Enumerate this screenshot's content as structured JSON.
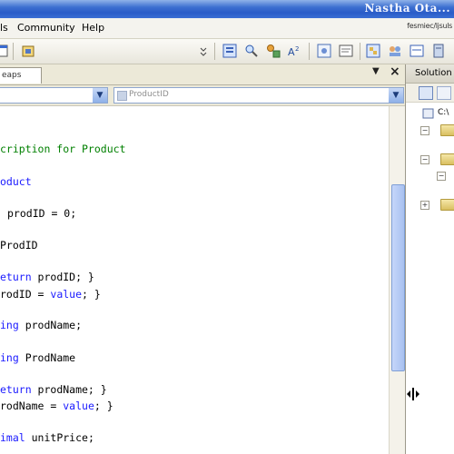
{
  "window": {
    "title": "Nastha Ota..."
  },
  "menu": {
    "items": [
      "ls",
      "Community",
      "Help"
    ],
    "user": "fesmiec/ljsuls"
  },
  "editor_tab": {
    "label": "eaps"
  },
  "nav": {
    "member_combo": "ProductID"
  },
  "code_lines": [
    {
      "segments": [
        {
          "t": "cription for Product",
          "c": "cm"
        }
      ]
    },
    {
      "segments": [
        {
          "t": "oduct",
          "c": "kw"
        }
      ]
    },
    {
      "segments": [
        {
          "t": "prodID = 0;",
          "c": ""
        }
      ]
    },
    {
      "segments": [
        {
          "t": "ProdID",
          "c": ""
        }
      ]
    },
    {
      "segments": [
        {
          "t": "eturn",
          "c": "kw"
        },
        {
          "t": " prodID; }",
          "c": ""
        }
      ]
    },
    {
      "segments": [
        {
          "t": "rodID = ",
          "c": ""
        },
        {
          "t": "value",
          "c": "kw"
        },
        {
          "t": "; }",
          "c": ""
        }
      ]
    },
    {
      "segments": [
        {
          "t": "ing",
          "c": "kw"
        },
        {
          "t": " prodName;",
          "c": ""
        }
      ]
    },
    {
      "segments": [
        {
          "t": "ing",
          "c": "kw"
        },
        {
          "t": " ProdName",
          "c": ""
        }
      ]
    },
    {
      "segments": [
        {
          "t": "eturn",
          "c": "kw"
        },
        {
          "t": " prodName; }",
          "c": ""
        }
      ]
    },
    {
      "segments": [
        {
          "t": "rodName = ",
          "c": ""
        },
        {
          "t": "value",
          "c": "kw"
        },
        {
          "t": "; }",
          "c": ""
        }
      ]
    },
    {
      "segments": [
        {
          "t": "imal",
          "c": "kw"
        },
        {
          "t": " unitPrice;",
          "c": ""
        }
      ]
    }
  ],
  "solution_panel": {
    "title": "Solution",
    "root_label": "C:\\"
  }
}
